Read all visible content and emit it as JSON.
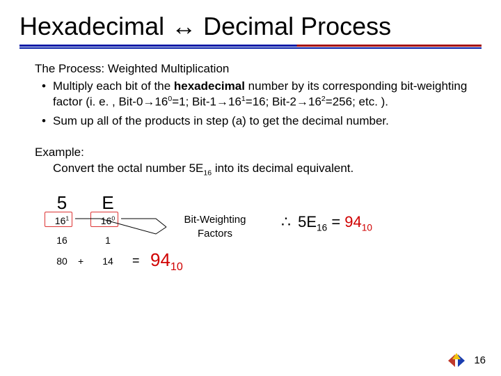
{
  "title": "Hexadecimal ↔ Decimal Process",
  "lead": "The Process: Weighted Multiplication",
  "bullets": {
    "a_pre": "Multiply each bit of the ",
    "a_bold": "hexadecimal",
    "a_post": " number by its corresponding bit-weighting factor (i. e. , Bit-0→16",
    "a_sup0": "0",
    "a_mid1": "=1; Bit-1→16",
    "a_sup1": "1",
    "a_mid2": "=16; Bit-2→16",
    "a_sup2": "2",
    "a_end": "=256; etc. ).",
    "b": "Sum up all of the products in step (a) to get the decimal number."
  },
  "example": {
    "label": "Example:",
    "line_pre": "Convert the octal number 5E",
    "line_sub": "16",
    "line_post": " into its decimal equivalent."
  },
  "work": {
    "d0": "5",
    "d1": "E",
    "w0_base": "16",
    "w0_exp": "1",
    "w1_base": "16",
    "w1_exp": "0",
    "v0": "16",
    "v1": "1",
    "p0": "80",
    "plus": "+",
    "p1": "14",
    "eq": "=",
    "result_val": "94",
    "result_sub": "10",
    "weights_label": "Bit-Weighting Factors"
  },
  "therefore": {
    "sym": "∴",
    "lhs_val": "5E",
    "lhs_sub": "16",
    "mid": " = ",
    "rhs_val": "94",
    "rhs_sub": "10"
  },
  "pagenum": "16"
}
